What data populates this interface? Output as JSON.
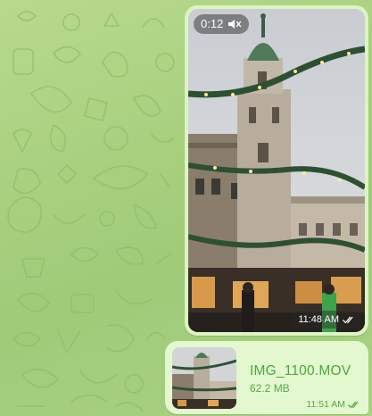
{
  "chat": {
    "video_message": {
      "duration": "0:12",
      "duration_icon": "muted-speaker-icon",
      "time": "11:48 AM",
      "status_icon": "double-check-icon"
    },
    "file_message": {
      "file_name": "IMG_1100.MOV",
      "file_size": "62.2 MB",
      "time": "11:51 AM",
      "status_icon": "double-check-icon"
    }
  },
  "colors": {
    "wallpaper": "#a8d07f",
    "outgoing_bubble": "#e3f8cf",
    "accent_green": "#4aa93b"
  }
}
